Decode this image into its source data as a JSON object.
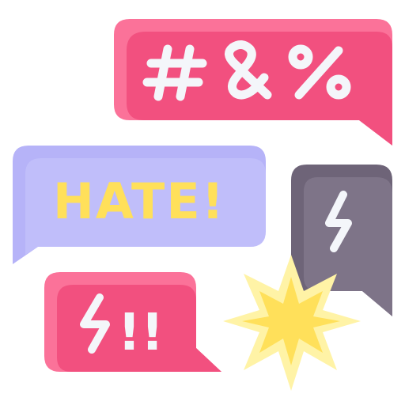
{
  "icon_name": "hate-speech-chat-bubbles",
  "colors": {
    "pink_dark": "#F2507F",
    "pink_light": "#FB7299",
    "lavender_dark": "#B6B3F8",
    "lavender_light": "#C9C6FB",
    "purple_gray": "#6E6478",
    "purple_gray_light": "#7E7488",
    "yellow_text": "#FFE05A",
    "star_outer": "#FFF3A6",
    "star_inner": "#FFE05A",
    "white": "#F4F6FA"
  },
  "bubbles": {
    "top": {
      "text": "#&%"
    },
    "middle": {
      "text": "HATE!"
    },
    "right": {
      "symbol": "lightning-icon"
    },
    "bottom": {
      "text": "!!",
      "symbol": "lightning-icon"
    }
  },
  "decor": {
    "burst": "starburst-icon"
  }
}
